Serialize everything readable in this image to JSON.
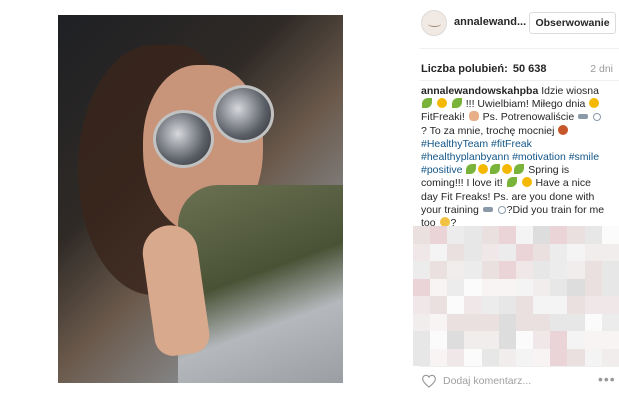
{
  "header": {
    "username": "annalewand...",
    "follow_label": "Obserwowanie"
  },
  "stats": {
    "likes_label": "Liczba polubień:",
    "likes_count": "50 638",
    "time_ago": "2 dni"
  },
  "caption": {
    "author": "annalewandowskahpba",
    "t1": "Idzie wiosna",
    "t2": "!!! Uwielbiam! Miłego dnia",
    "t3": "FitFreaki!",
    "t4": "Ps. Potrenowaliście",
    "t5": "?",
    "t6": "To za mnie, trochę mocniej",
    "hashtags": [
      "#HealthyTeam",
      "#fitFreak",
      "#healthyplanbyann",
      "#motivation",
      "#smile",
      "#positive"
    ],
    "t7": "Spring is coming!!! I love it!",
    "t8": "Have a nice day Fit Freaks! Ps. are you done with your training",
    "t9": "?Did you train for me too",
    "t10": "?"
  },
  "footer": {
    "comment_placeholder": "Dodaj komentarz...",
    "more_label": "•••"
  },
  "icons": {
    "avatar": "avatar-icon",
    "like": "heart-icon",
    "more": "more-options-icon"
  },
  "colors": {
    "hashtag": "#125688",
    "muted": "#999999",
    "border": "#dbdbdb"
  }
}
